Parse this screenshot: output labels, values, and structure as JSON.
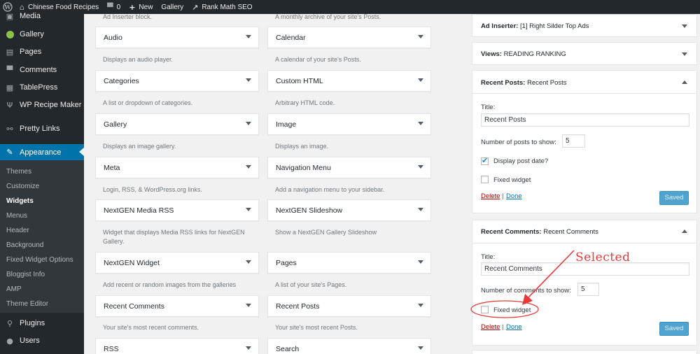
{
  "adminbar": {
    "site_name": "Chinese Food Recipes",
    "comments_count": "0",
    "new_label": "New",
    "gallery_label": "Gallery",
    "rankmath_label": "Rank Math SEO"
  },
  "menu": {
    "items": [
      {
        "label": "Media",
        "icon": "media-icon"
      },
      {
        "label": "Gallery",
        "icon": "gallery-icon"
      },
      {
        "label": "Pages",
        "icon": "pages-icon"
      },
      {
        "label": "Comments",
        "icon": "comments-icon"
      },
      {
        "label": "TablePress",
        "icon": "table-icon"
      },
      {
        "label": "WP Recipe Maker",
        "icon": "fork-knife-icon"
      },
      {
        "label": "Pretty Links",
        "icon": "link-icon"
      },
      {
        "label": "Appearance",
        "icon": "paintbrush-icon"
      }
    ],
    "submenu": [
      "Themes",
      "Customize",
      "Widgets",
      "Menus",
      "Header",
      "Background",
      "Fixed Widget Options",
      "Bloggist Info",
      "AMP",
      "Theme Editor"
    ],
    "bottom": [
      {
        "label": "Plugins",
        "icon": "plugin-icon"
      },
      {
        "label": "Users",
        "icon": "users-icon"
      }
    ]
  },
  "widgets": {
    "left_top_desc": "Ad Inserter block.",
    "right_top_desc": "A monthly archive of your site's Posts.",
    "left": [
      {
        "title": "Audio",
        "desc": "Displays an audio player."
      },
      {
        "title": "Categories",
        "desc": "A list or dropdown of categories."
      },
      {
        "title": "Gallery",
        "desc": "Displays an image gallery."
      },
      {
        "title": "Meta",
        "desc": "Login, RSS, & WordPress.org links."
      },
      {
        "title": "NextGEN Media RSS",
        "desc": "Widget that displays Media RSS links for NextGEN Gallery."
      },
      {
        "title": "NextGEN Widget",
        "desc": "Add recent or random images from the galleries"
      },
      {
        "title": "Recent Comments",
        "desc": "Your site's most recent comments."
      },
      {
        "title": "RSS",
        "desc": ""
      }
    ],
    "right": [
      {
        "title": "Calendar",
        "desc": "A calendar of your site's Posts."
      },
      {
        "title": "Custom HTML",
        "desc": "Arbitrary HTML code."
      },
      {
        "title": "Image",
        "desc": "Displays an image."
      },
      {
        "title": "Navigation Menu",
        "desc": "Add a navigation menu to your sidebar."
      },
      {
        "title": "NextGEN Slideshow",
        "desc": "Show a NextGEN Gallery Slideshow"
      },
      {
        "title": "Pages",
        "desc": "A list of your site's Pages."
      },
      {
        "title": "Recent Posts",
        "desc": "Your site's most recent Posts."
      },
      {
        "title": "Search",
        "desc": ""
      }
    ]
  },
  "sidebar": {
    "ad_inserter": {
      "type": "Ad Inserter:",
      "title": "[1] Right Silder Top Ads"
    },
    "views": {
      "type": "Views:",
      "title": "READING RANKING"
    },
    "recent_posts": {
      "type": "Recent Posts:",
      "title": "Recent Posts",
      "title_label": "Title:",
      "title_value": "Recent Posts",
      "number_label": "Number of posts to show:",
      "number_value": "5",
      "date_label": "Display post date?",
      "date_checked": true,
      "fixed_label": "Fixed widget",
      "fixed_checked": false,
      "delete": "Delete",
      "sep": "|",
      "done": "Done",
      "saved": "Saved"
    },
    "recent_comments": {
      "type": "Recent Comments:",
      "title": "Recent Comments",
      "title_label": "Title:",
      "title_value": "Recent Comments",
      "number_label": "Number of comments to show:",
      "number_value": "5",
      "fixed_label": "Fixed widget",
      "fixed_checked": false,
      "delete": "Delete",
      "sep": "|",
      "done": "Done",
      "saved": "Saved"
    }
  },
  "annotation": {
    "text": "Selected",
    "color": "#e83a3a"
  },
  "colors": {
    "accent": "#0073aa",
    "admin_dark": "#23282d",
    "saved_button": "#4fa3cf"
  }
}
